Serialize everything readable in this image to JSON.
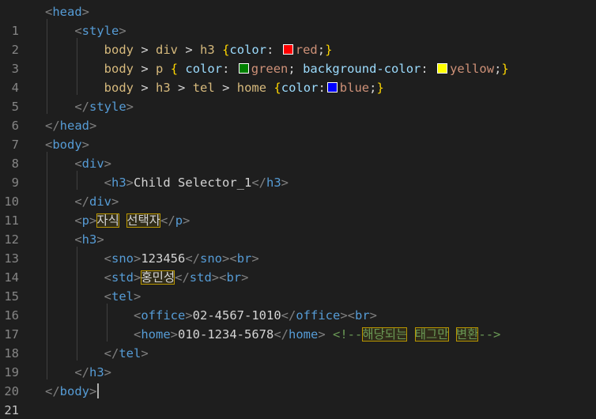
{
  "editor": {
    "line_numbers": [
      "1",
      "2",
      "3",
      "4",
      "5",
      "6",
      "7",
      "8",
      "9",
      "10",
      "11",
      "12",
      "13",
      "14",
      "15",
      "16",
      "17",
      "18",
      "19",
      "20",
      "21"
    ],
    "active_line": "21"
  },
  "tokens": {
    "head": "head",
    "style": "style",
    "body": "body",
    "div": "div",
    "h3": "h3",
    "p": "p",
    "tel": "tel",
    "home": "home",
    "sno": "sno",
    "std": "std",
    "office": "office",
    "br": "br",
    "css_color": "color",
    "css_bg_color": "background-color",
    "red": "red",
    "green": "green",
    "yellow": "yellow",
    "blue": "blue"
  },
  "content": {
    "h3_text": "Child Selector_1",
    "p_text_1": "자식",
    "p_text_2": "선택자",
    "sno_text": "123456",
    "std_text": "홍민성",
    "office_text": "02-4567-1010",
    "home_text": "010-1234-5678",
    "comment_open": "<!--",
    "comment_w1": "해당되는",
    "comment_w2": "태그만",
    "comment_w3": "변환",
    "comment_close": "-->"
  },
  "colors": {
    "swatch_red": "#ff0000",
    "swatch_green": "#008000",
    "swatch_yellow": "#ffff00",
    "swatch_blue": "#0000ff"
  }
}
